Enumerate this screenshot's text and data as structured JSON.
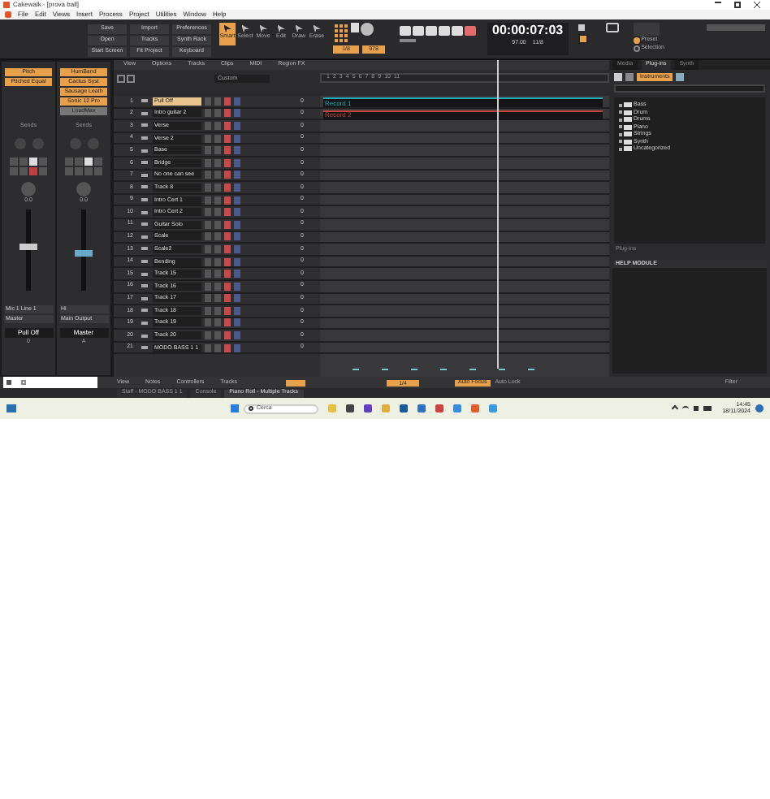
{
  "window": {
    "title": "Cakewalk - [prova ball]"
  },
  "menu": [
    "File",
    "Edit",
    "Views",
    "Insert",
    "Process",
    "Project",
    "Utilities",
    "Window",
    "Help"
  ],
  "control_bar": {
    "buttons": [
      "Save",
      "Import",
      "Preferences",
      "Open",
      "Tracks",
      "Synth Rack",
      "Start Screen",
      "Fit Project",
      "Keyboard"
    ],
    "tools": [
      {
        "label": "Smart",
        "selected": true
      },
      {
        "label": "Select",
        "selected": false
      },
      {
        "label": "Move",
        "selected": false
      },
      {
        "label": "Edit",
        "selected": false
      },
      {
        "label": "Draw",
        "selected": false
      },
      {
        "label": "Erase",
        "selected": false
      }
    ],
    "snap": "1/8",
    "marks": "978",
    "time": "00:00:07:03",
    "tempo": "97.00",
    "meter": "11/8",
    "modes": [
      {
        "label": "Preset",
        "selected": true
      },
      {
        "label": "Selection",
        "selected": false
      }
    ]
  },
  "mixer": {
    "strips": [
      {
        "name": "Pull Off",
        "fx": [
          "Pitch",
          "Pitched Equal"
        ],
        "sends": "Sends",
        "pan": "0.0",
        "input": "Mic 1 Line 1",
        "output": "Master",
        "number": "0",
        "level": 0.55
      },
      {
        "name": "Master",
        "fx": [
          "HumBand",
          "Cactus Syst",
          "Sausage Leath",
          "Sonic 12 Pro",
          "LoudMax"
        ],
        "sends": "Sends",
        "pan": "0.0",
        "input": "Hi",
        "output": "Main Output",
        "number": "A",
        "level": 0.45
      }
    ]
  },
  "tracks_view": {
    "menu": [
      "View",
      "Options",
      "Tracks",
      "Clips",
      "MIDI",
      "Region FX"
    ],
    "preset": "Custom",
    "ruler": [
      "1",
      "2",
      "3",
      "4",
      "5",
      "6",
      "7",
      "8",
      "9",
      "10",
      "11"
    ],
    "tracks": [
      {
        "number": "1",
        "name": "Pull Off",
        "selected": true,
        "value": "0",
        "clip": {
          "name": "Record 1",
          "color": "#22a9b8"
        }
      },
      {
        "number": "2",
        "name": "Intro guitar 2",
        "selected": false,
        "value": "0",
        "clip": {
          "name": "Record 2",
          "color": "#c0443a"
        }
      },
      {
        "number": "3",
        "name": "Verse",
        "selected": false,
        "value": "0"
      },
      {
        "number": "4",
        "name": "Verse 2",
        "selected": false,
        "value": "0"
      },
      {
        "number": "5",
        "name": "Base",
        "selected": false,
        "value": "0"
      },
      {
        "number": "6",
        "name": "Bridge",
        "selected": false,
        "value": "0"
      },
      {
        "number": "7",
        "name": "No one can see",
        "selected": false,
        "value": "0"
      },
      {
        "number": "8",
        "name": "Track 8",
        "selected": false,
        "value": "0"
      },
      {
        "number": "9",
        "name": "Intro Cert 1",
        "selected": false,
        "value": "0"
      },
      {
        "number": "10",
        "name": "Intro Cert 2",
        "selected": false,
        "value": "0"
      },
      {
        "number": "11",
        "name": "Guitar Solo",
        "selected": false,
        "value": "0"
      },
      {
        "number": "12",
        "name": "Scale",
        "selected": false,
        "value": "0"
      },
      {
        "number": "13",
        "name": "Scale2",
        "selected": false,
        "value": "0"
      },
      {
        "number": "14",
        "name": "Bending",
        "selected": false,
        "value": "0"
      },
      {
        "number": "15",
        "name": "Track 15",
        "selected": false,
        "value": "0"
      },
      {
        "number": "16",
        "name": "Track 16",
        "selected": false,
        "value": "0"
      },
      {
        "number": "17",
        "name": "Track 17",
        "selected": false,
        "value": "0"
      },
      {
        "number": "18",
        "name": "Track 18",
        "selected": false,
        "value": "0"
      },
      {
        "number": "19",
        "name": "Track 19",
        "selected": false,
        "value": "0"
      },
      {
        "number": "20",
        "name": "Track 20",
        "selected": false,
        "value": "0"
      },
      {
        "number": "21",
        "name": "MODO BASS 1 1",
        "selected": false,
        "value": "0"
      }
    ]
  },
  "browser": {
    "tabs": [
      {
        "label": "Media",
        "selected": false
      },
      {
        "label": "Plug-ins",
        "selected": true
      },
      {
        "label": "Synth",
        "selected": false
      }
    ],
    "category": "Instruments",
    "folders": [
      "Bass",
      "Drum",
      "Drums",
      "Piano",
      "Strings",
      "Synth",
      "Uncategorized"
    ],
    "footer": "Plug-ins",
    "help_title": "HELP MODULE"
  },
  "bottom_bar": {
    "menu": [
      "View",
      "Notes",
      "Controllers",
      "Tracks"
    ],
    "snap": "1/4",
    "auto_focus": "Auto Focus",
    "auto_lock": "Auto Lock",
    "filter": "Filter"
  },
  "view_tabs": [
    {
      "label": "Staff - MODO BASS 1 1",
      "selected": false
    },
    {
      "label": "Console",
      "selected": false
    },
    {
      "label": "Piano Roll - Multiple Tracks",
      "selected": true
    }
  ],
  "taskbar": {
    "search": "Cerca",
    "time": "14:45",
    "date": "18/11/2024"
  }
}
